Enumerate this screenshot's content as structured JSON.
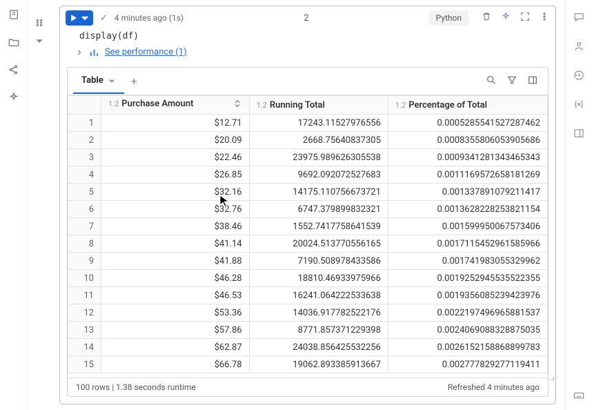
{
  "toolbar": {
    "time_ago": "4 minutes ago (1s)",
    "cell_count": "2",
    "language": "Python"
  },
  "code": "display(df)",
  "perf": {
    "label": "See performance (1)"
  },
  "tab": {
    "label": "Table"
  },
  "columns": [
    {
      "type": "1.2",
      "name": "Purchase Amount"
    },
    {
      "type": "1.2",
      "name": "Running Total"
    },
    {
      "type": "1.2",
      "name": "Percentage of Total"
    }
  ],
  "rows": [
    {
      "n": 1,
      "purchase": "$12.71",
      "running": "17243.11527976556",
      "pct": "0.0005285541527287462"
    },
    {
      "n": 2,
      "purchase": "$20.09",
      "running": "2668.75640837305",
      "pct": "0.0008355806053905686"
    },
    {
      "n": 3,
      "purchase": "$22.46",
      "running": "23975.989626305538",
      "pct": "0.0009341281343465343"
    },
    {
      "n": 4,
      "purchase": "$26.85",
      "running": "9692.092072527683",
      "pct": "0.0011169572658181269"
    },
    {
      "n": 5,
      "purchase": "$32.16",
      "running": "14175.110756673721",
      "pct": "0.001337891079211417"
    },
    {
      "n": 6,
      "purchase": "$32.76",
      "running": "6747.379899832321",
      "pct": "0.0013628228253821154"
    },
    {
      "n": 7,
      "purchase": "$38.46",
      "running": "1552.7417758641539",
      "pct": "0.001599950067573406"
    },
    {
      "n": 8,
      "purchase": "$41.14",
      "running": "20024.513770556165",
      "pct": "0.0017115452961585966"
    },
    {
      "n": 9,
      "purchase": "$41.88",
      "running": "7190.508978433586",
      "pct": "0.001741983055329962"
    },
    {
      "n": 10,
      "purchase": "$46.28",
      "running": "18810.46933975966",
      "pct": "0.0019252945535522355"
    },
    {
      "n": 11,
      "purchase": "$46.53",
      "running": "16241.064222533638",
      "pct": "0.0019356085239423976"
    },
    {
      "n": 12,
      "purchase": "$53.36",
      "running": "14036.917782522176",
      "pct": "0.0022197496965881537"
    },
    {
      "n": 13,
      "purchase": "$57.86",
      "running": "8771.857371229398",
      "pct": "0.0024069088328875035"
    },
    {
      "n": 14,
      "purchase": "$62.87",
      "running": "24038.856425532256",
      "pct": "0.0026152158868899783"
    },
    {
      "n": 15,
      "purchase": "$66.78",
      "running": "19062.893385913667",
      "pct": "0.002777829277119411"
    }
  ],
  "footer": {
    "left": "100 rows  |  1.38 seconds runtime",
    "right": "Refreshed 4 minutes ago"
  }
}
